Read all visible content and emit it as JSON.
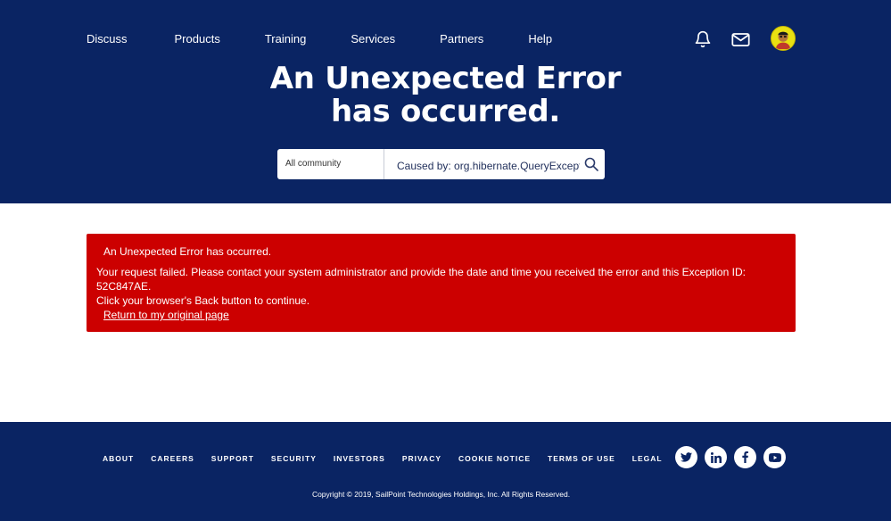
{
  "nav": {
    "items": [
      {
        "label": "Discuss"
      },
      {
        "label": "Products"
      },
      {
        "label": "Training"
      },
      {
        "label": "Services"
      },
      {
        "label": "Partners"
      },
      {
        "label": "Help"
      }
    ],
    "icons": [
      "bell-icon",
      "mail-icon",
      "avatar"
    ]
  },
  "hero": {
    "title_line1": "An Unexpected Error",
    "title_line2": "has occurred."
  },
  "search": {
    "scope": "All community",
    "value": "Caused by: org.hibernate.QueryExcepti",
    "icon": "search-icon"
  },
  "error": {
    "title": "An Unexpected Error has occurred.",
    "message_line1": "Your request failed. Please contact your system administrator and provide the date and time you received the error and this Exception ID:",
    "exception_id": "52C847AE.",
    "instruction": "Click your browser's Back button to continue.",
    "return_link": "Return to my original page",
    "background_color": "#cc0000"
  },
  "footer": {
    "links": [
      {
        "label": "ABOUT"
      },
      {
        "label": "CAREERS"
      },
      {
        "label": "SUPPORT"
      },
      {
        "label": "SECURITY"
      },
      {
        "label": "INVESTORS"
      },
      {
        "label": "PRIVACY"
      },
      {
        "label": "COOKIE NOTICE"
      },
      {
        "label": "TERMS OF USE"
      },
      {
        "label": "LEGAL"
      }
    ],
    "social": [
      "twitter-icon",
      "linkedin-icon",
      "facebook-icon",
      "youtube-icon"
    ],
    "copyright": "Copyright © 2019, SailPoint Technologies Holdings, Inc. All Rights Reserved."
  },
  "colors": {
    "brand_navy": "#0a2463",
    "error_red": "#cc0000",
    "avatar_yellow": "#e8e012"
  }
}
